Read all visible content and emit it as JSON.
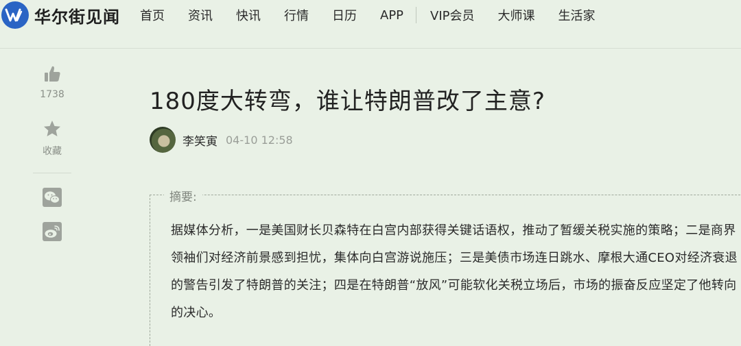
{
  "header": {
    "logo_text": "华尔街见闻",
    "nav": [
      "首页",
      "资讯",
      "快讯",
      "行情",
      "日历",
      "APP"
    ],
    "nav_right": [
      "VIP会员",
      "大师课",
      "生活家"
    ]
  },
  "sidebar": {
    "like_count": "1738",
    "favorite_label": "收藏"
  },
  "article": {
    "title": "180度大转弯，谁让特朗普改了主意?",
    "author": "李笑寅",
    "time": "04-10 12:58",
    "summary_label": "摘要:",
    "summary": "据媒体分析，一是美国财长贝森特在白宫内部获得关键话语权，推动了暂缓关税实施的策略；二是商界领袖们对经济前景感到担忧，集体向白宫游说施压；三是美债市场连日跳水、摩根大通CEO对经济衰退的警告引发了特朗普的关注；四是在特朗普“放风”可能软化关税立场后，市场的振奋反应坚定了他转向的决心。"
  },
  "colors": {
    "background": "#e9f1e6",
    "logo_blue": "#2a64c4",
    "icon_gray": "#9ea39c"
  },
  "icons": [
    "logo-w-icon",
    "thumbs-up-icon",
    "star-icon",
    "wechat-icon",
    "weibo-icon"
  ]
}
